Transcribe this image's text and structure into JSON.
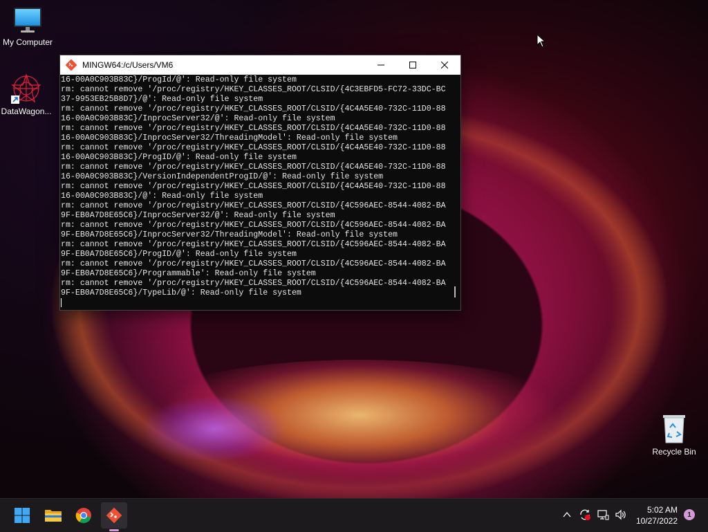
{
  "desktop": {
    "icons": [
      {
        "label": "My Computer",
        "icon": "monitor-icon"
      },
      {
        "label": "DataWagon...",
        "icon": "datawagon-shortcut-icon"
      },
      {
        "label": "Recycle Bin",
        "icon": "recycle-bin-icon"
      }
    ]
  },
  "window": {
    "title": "MINGW64:/c/Users/VM6",
    "icon": "git-bash-icon",
    "lines": [
      "16-00A0C903B83C}/ProgId/@': Read-only file system",
      "rm: cannot remove '/proc/registry/HKEY_CLASSES_ROOT/CLSID/{4C3EBFD5-FC72-33DC-BC",
      "37-9953EB25B8D7}/@': Read-only file system",
      "rm: cannot remove '/proc/registry/HKEY_CLASSES_ROOT/CLSID/{4C4A5E40-732C-11D0-88",
      "16-00A0C903B83C}/InprocServer32/@': Read-only file system",
      "rm: cannot remove '/proc/registry/HKEY_CLASSES_ROOT/CLSID/{4C4A5E40-732C-11D0-88",
      "16-00A0C903B83C}/InprocServer32/ThreadingModel': Read-only file system",
      "rm: cannot remove '/proc/registry/HKEY_CLASSES_ROOT/CLSID/{4C4A5E40-732C-11D0-88",
      "16-00A0C903B83C}/ProgID/@': Read-only file system",
      "rm: cannot remove '/proc/registry/HKEY_CLASSES_ROOT/CLSID/{4C4A5E40-732C-11D0-88",
      "16-00A0C903B83C}/VersionIndependentProgID/@': Read-only file system",
      "rm: cannot remove '/proc/registry/HKEY_CLASSES_ROOT/CLSID/{4C4A5E40-732C-11D0-88",
      "16-00A0C903B83C}/@': Read-only file system",
      "rm: cannot remove '/proc/registry/HKEY_CLASSES_ROOT/CLSID/{4C596AEC-8544-4082-BA",
      "9F-EB0A7D8E65C6}/InprocServer32/@': Read-only file system",
      "rm: cannot remove '/proc/registry/HKEY_CLASSES_ROOT/CLSID/{4C596AEC-8544-4082-BA",
      "9F-EB0A7D8E65C6}/InprocServer32/ThreadingModel': Read-only file system",
      "rm: cannot remove '/proc/registry/HKEY_CLASSES_ROOT/CLSID/{4C596AEC-8544-4082-BA",
      "9F-EB0A7D8E65C6}/ProgID/@': Read-only file system",
      "rm: cannot remove '/proc/registry/HKEY_CLASSES_ROOT/CLSID/{4C596AEC-8544-4082-BA",
      "9F-EB0A7D8E65C6}/Programmable': Read-only file system",
      "rm: cannot remove '/proc/registry/HKEY_CLASSES_ROOT/CLSID/{4C596AEC-8544-4082-BA",
      "9F-EB0A7D8E65C6}/TypeLib/@': Read-only file system"
    ]
  },
  "taskbar": {
    "apps": [
      {
        "name": "start-button",
        "icon": "windows-logo-icon"
      },
      {
        "name": "file-explorer-button",
        "icon": "folder-icon"
      },
      {
        "name": "chrome-button",
        "icon": "chrome-icon"
      },
      {
        "name": "git-bash-taskbar-button",
        "icon": "git-bash-icon",
        "active": true
      }
    ],
    "tray_icons": [
      "chevron-up-icon",
      "sync-error-icon",
      "network-icon",
      "volume-icon"
    ],
    "time": "5:02 AM",
    "date": "10/27/2022",
    "notification_count": "1"
  },
  "colors": {
    "taskbar_bg": "#1c1a1d",
    "terminal_bg": "#0c0c0c",
    "terminal_fg": "#e6e6e6",
    "accent": "#d39bd6"
  }
}
